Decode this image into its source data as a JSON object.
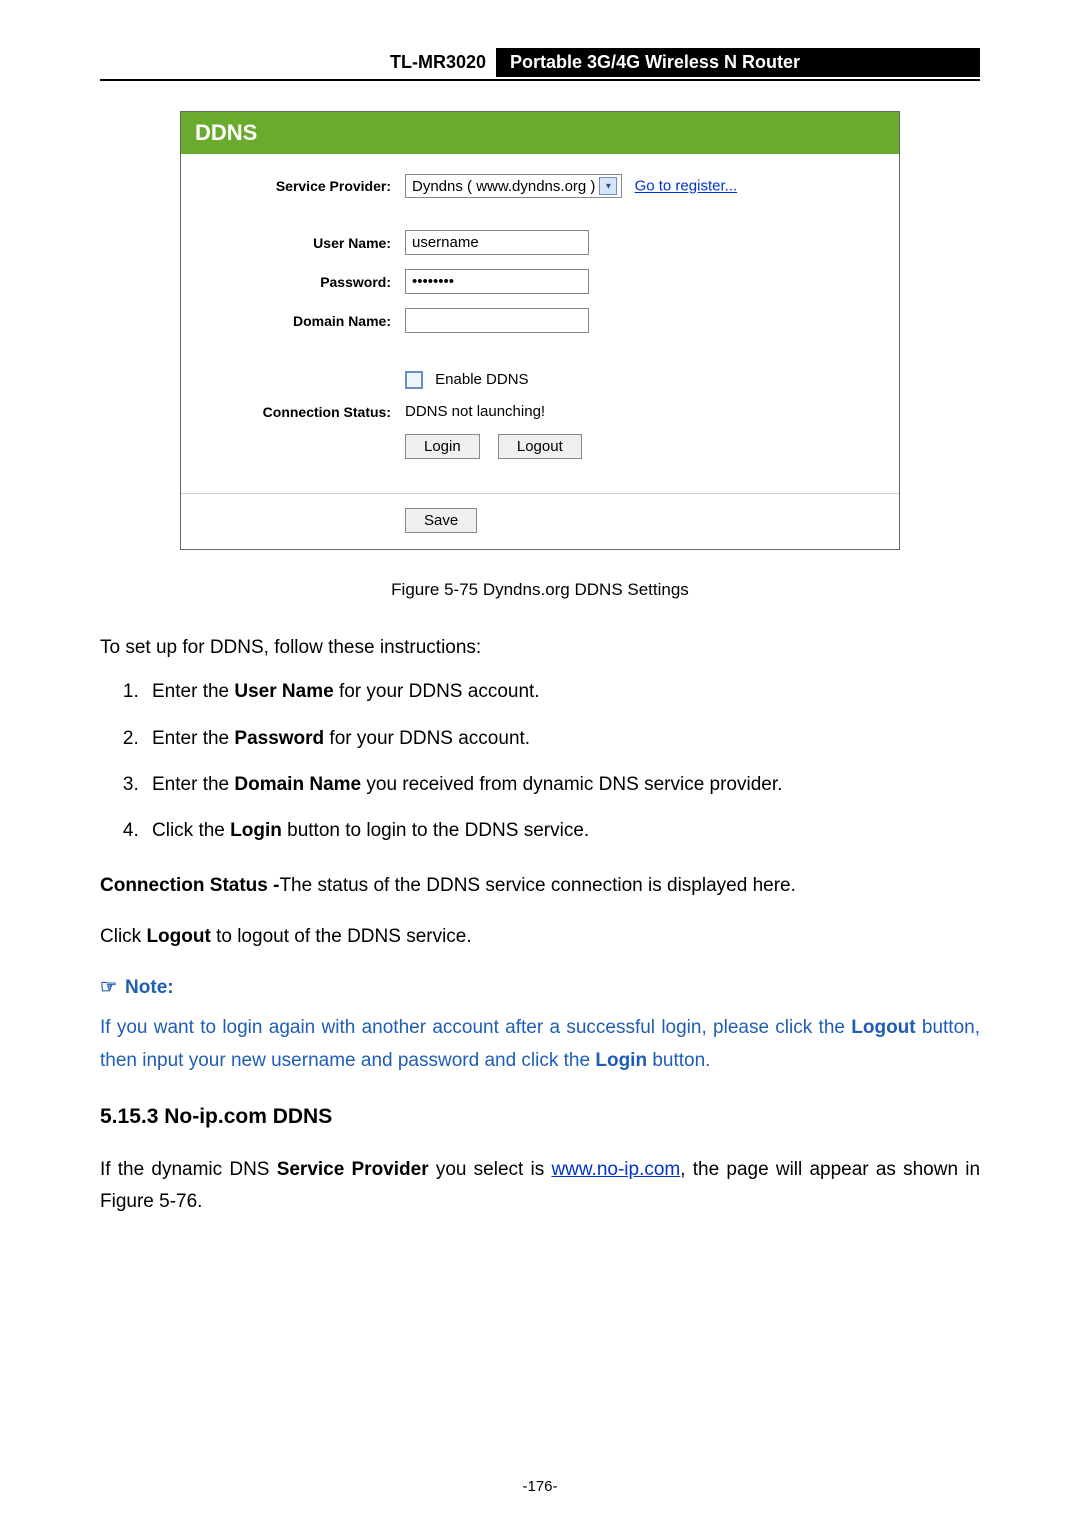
{
  "header": {
    "model": "TL-MR3020",
    "title": "Portable 3G/4G Wireless N Router"
  },
  "figure": {
    "banner": "DDNS",
    "labels": {
      "service_provider": "Service Provider:",
      "user_name": "User Name:",
      "password": "Password:",
      "domain_name": "Domain Name:",
      "connection_status": "Connection Status:"
    },
    "values": {
      "provider_option": "Dyndns ( www.dyndns.org )",
      "register_link": "Go to register...",
      "username": "username",
      "password_masked": "••••••••",
      "domain_name": "",
      "enable_label": "Enable DDNS",
      "status_text": "DDNS not launching!"
    },
    "buttons": {
      "login": "Login",
      "logout": "Logout",
      "save": "Save"
    },
    "caption": "Figure 5-75    Dyndns.org DDNS Settings"
  },
  "body": {
    "intro": "To set up for DDNS, follow these instructions:",
    "steps": {
      "s1a": "Enter the ",
      "s1b": "User Name",
      "s1c": " for your DDNS account.",
      "s2a": "Enter the ",
      "s2b": "Password",
      "s2c": " for your DDNS account.",
      "s3a": "Enter the ",
      "s3b": "Domain Name",
      "s3c": " you received from dynamic DNS service provider.",
      "s4a": "Click the ",
      "s4b": "Login",
      "s4c": " button to login to the DDNS service."
    },
    "conn_status_label": "Connection Status -",
    "conn_status_text": "The status of the DDNS service connection is displayed here.",
    "logout_a": "Click ",
    "logout_b": "Logout",
    "logout_c": " to logout of the DDNS service.",
    "note_heading": "Note:",
    "note_a": "If you want to login again with another account after a successful login, please click the ",
    "note_b": "Logout",
    "note_c": " button, then input your new username and password and click the ",
    "note_d": "Login",
    "note_e": " button.",
    "section_heading": "5.15.3  No-ip.com DDNS",
    "sec_a": "If the dynamic DNS ",
    "sec_b": "Service Provider",
    "sec_c": " you select is ",
    "sec_link": "www.no-ip.com",
    "sec_d": ", the page will appear as shown in Figure 5-76."
  },
  "page_number": "-176-"
}
